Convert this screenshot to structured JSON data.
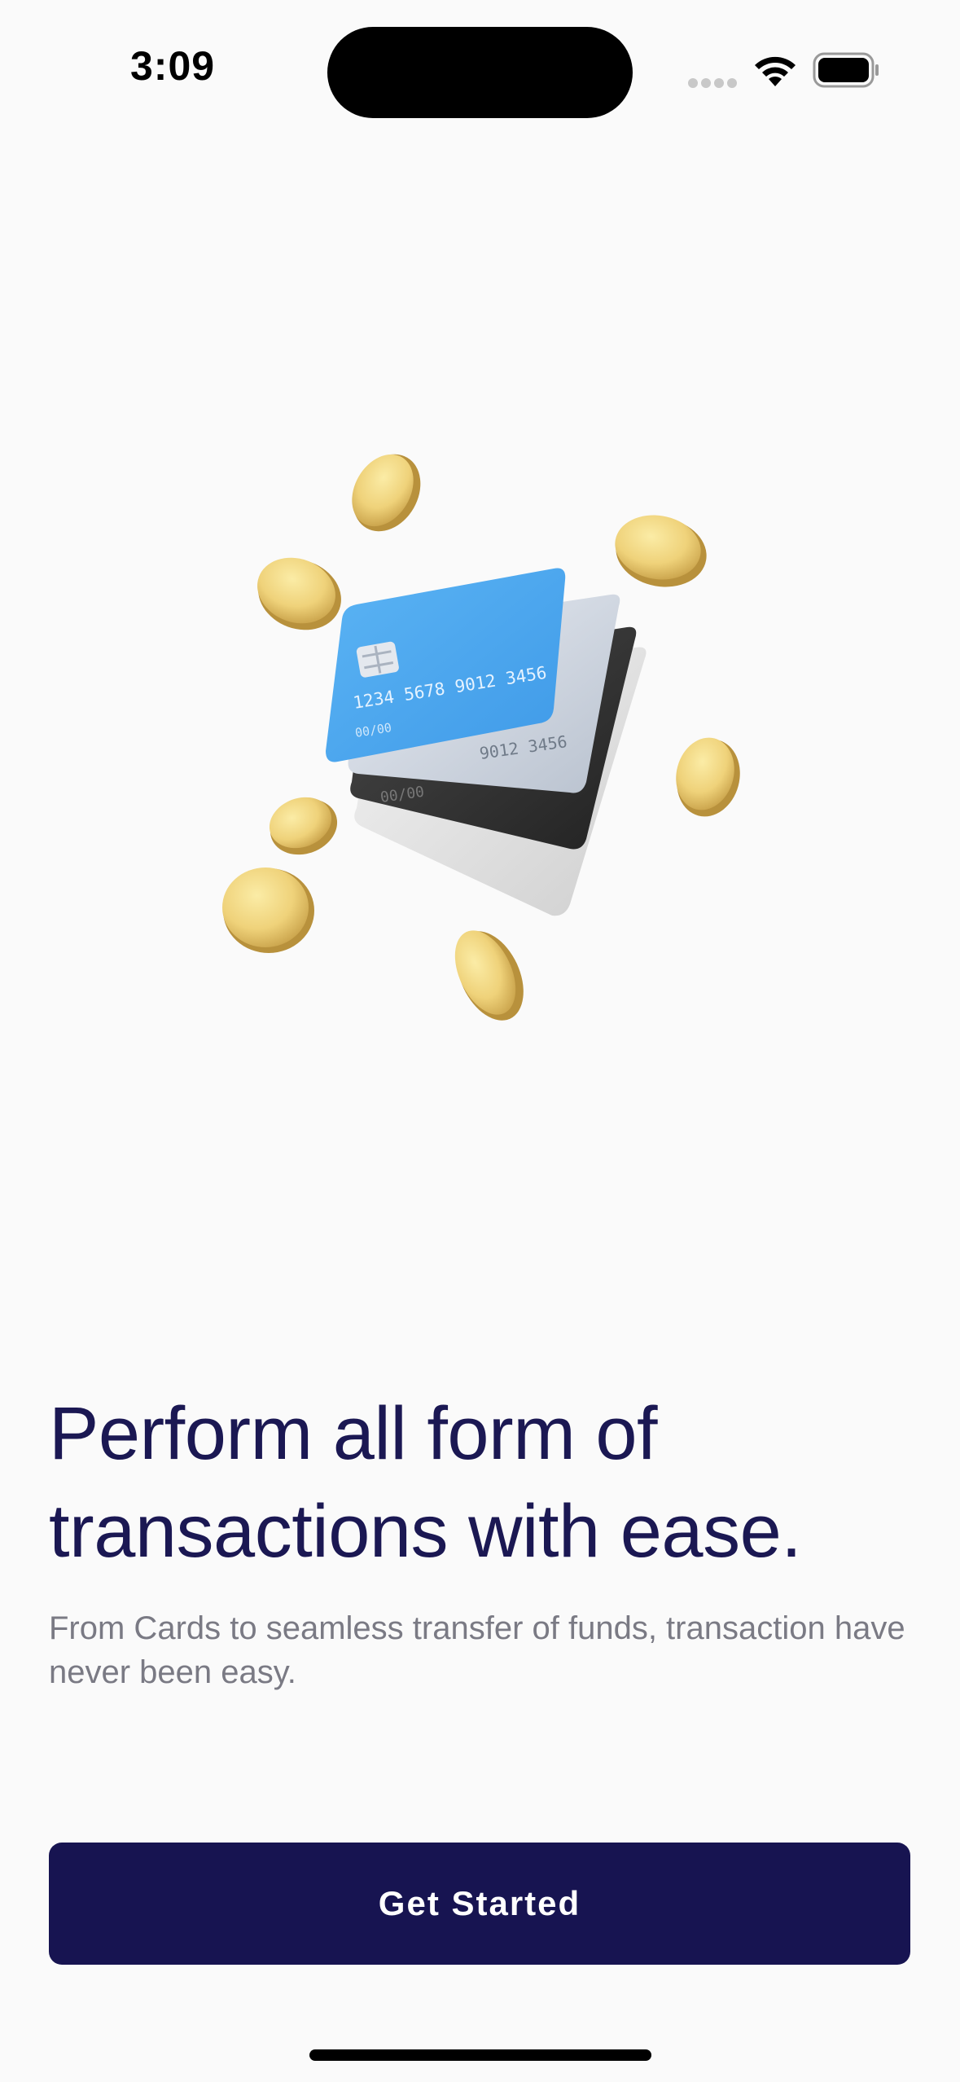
{
  "status_bar": {
    "time": "3:09"
  },
  "illustration": {
    "card_number": "1234 5678 9012 3456",
    "card_back_number": "9012 3456",
    "card_expiry": "00/00",
    "icon": "credit-cards-with-coins"
  },
  "onboarding": {
    "headline_line1": "Perform all form of",
    "headline_line2": "transactions with ease.",
    "subtext": "From Cards to seamless transfer of funds, transaction have never been easy.",
    "cta_label": "Get Started"
  },
  "colors": {
    "background": "#fafafa",
    "headline": "#1b1853",
    "subtext": "#7a7a84",
    "button": "#171451",
    "card_blue": "#4aa6ef",
    "coin_gold": "#e8c96a"
  }
}
